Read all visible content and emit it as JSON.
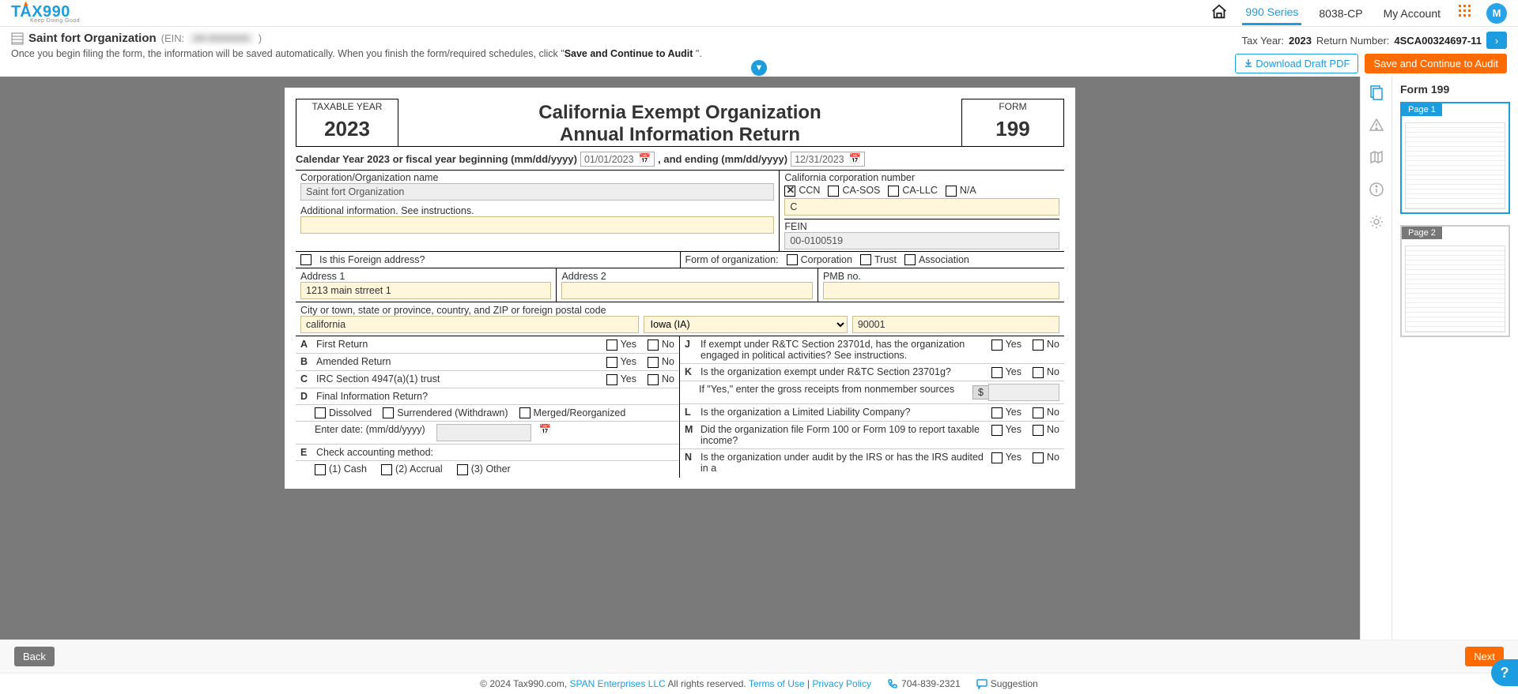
{
  "brand": {
    "name": "TAX990",
    "tagline": "Keep Doing Good"
  },
  "nav": {
    "series": "990 Series",
    "cp": "8038-CP",
    "account": "My Account",
    "avatar_initial": "M"
  },
  "org": {
    "name": "Saint fort Organization",
    "ein_prefix": "(EIN:",
    "ein_suffix": ")",
    "ein_masked": "00-0000000"
  },
  "autosave": {
    "prefix": "Once you begin filing the form, the information will be saved automatically. When you finish the form/required schedules, click \"",
    "bold": "Save and Continue to Audit",
    "suffix": " \"."
  },
  "meta": {
    "tax_year_label": "Tax Year:",
    "tax_year": "2023",
    "return_no_label": "Return Number:",
    "return_no": "4SCA00324697-11"
  },
  "buttons": {
    "download_draft": "Download Draft PDF",
    "save_continue": "Save and Continue to Audit",
    "back": "Back",
    "next": "Next"
  },
  "form": {
    "taxable_year_label": "TAXABLE YEAR",
    "taxable_year": "2023",
    "form_label": "FORM",
    "form_no": "199",
    "title_line1": "California Exempt Organization",
    "title_line2": "Annual Information Return",
    "cal_year_prefix": "Calendar Year 2023 or fiscal year beginning (mm/dd/yyyy)",
    "date_begin": "01/01/2023",
    "and_ending": ", and ending (mm/dd/yyyy)",
    "date_end": "12/31/2023",
    "corp_name_label": "Corporation/Organization name",
    "corp_name_value": "Saint fort Organization",
    "addl_info_label": "Additional information. See instructions.",
    "addl_info_value": "",
    "ca_corp_label": "California corporation number",
    "ccn": "CCN",
    "casos": "CA-SOS",
    "callc": "CA-LLC",
    "na": "N/A",
    "ca_corp_value": "C",
    "fein_label": "FEIN",
    "fein_value": "00-0100519",
    "foreign_addr": "Is this Foreign address?",
    "form_of_org_label": "Form of organization:",
    "corp": "Corporation",
    "trust": "Trust",
    "assoc": "Association",
    "addr1_label": "Address 1",
    "addr1_value": "1213 main strreet 1",
    "addr2_label": "Address 2",
    "addr2_value": "",
    "pmb_label": "PMB no.",
    "pmb_value": "",
    "city_label": "City or town, state or province, country, and ZIP or foreign postal code",
    "city_value": "california",
    "state_value": "Iowa (IA)",
    "zip_value": "90001",
    "yes": "Yes",
    "no": "No",
    "qA": "First Return",
    "qB": "Amended Return",
    "qC": "IRC Section 4947(a)(1) trust",
    "qD": "Final Information Return?",
    "qD_dissolved": "Dissolved",
    "qD_surrendered": "Surrendered (Withdrawn)",
    "qD_merged": "Merged/Reorganized",
    "qD_enter_date": "Enter date: (mm/dd/yyyy)",
    "qE": "Check accounting method:",
    "qE1": "(1) Cash",
    "qE2": "(2) Accrual",
    "qE3": "(3) Other",
    "qJ": "If exempt under R&TC Section 23701d, has the organization engaged in political activities? See instructions.",
    "qK": "Is the organization exempt under R&TC Section 23701g?",
    "qK_sub": "If \"Yes,\" enter the gross receipts from nonmember sources",
    "qL": "Is the organization a Limited Liability Company?",
    "qM": "Did the organization file Form 100 or Form 109 to report taxable income?",
    "qN": "Is the organization under audit by the IRS or has the IRS audited in a"
  },
  "thumbs": {
    "title": "Form 199",
    "page1": "Page 1",
    "page2": "Page 2"
  },
  "footer": {
    "copyright": "© 2024 Tax990.com,",
    "span": "SPAN Enterprises LLC",
    "rights": "All rights reserved.",
    "terms": "Terms of Use",
    "privacy": "Privacy Policy",
    "phone": "704-839-2321",
    "suggestion": "Suggestion"
  }
}
